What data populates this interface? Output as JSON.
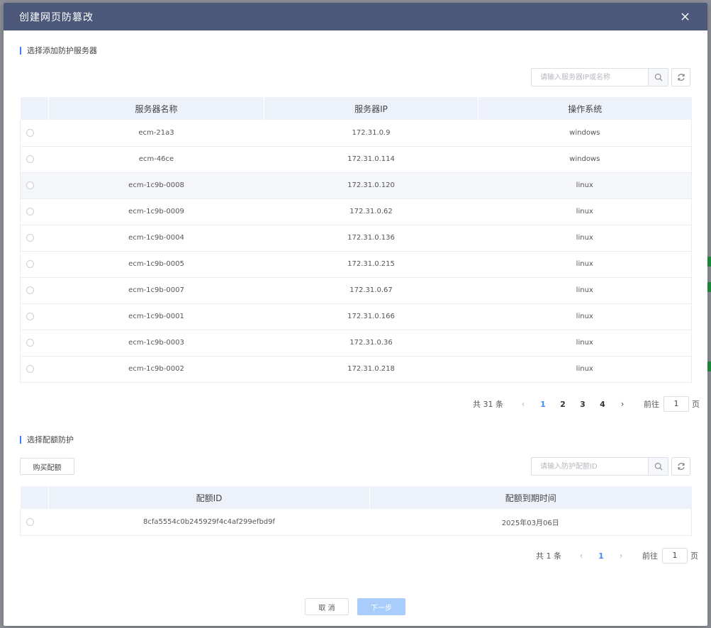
{
  "dialog": {
    "title": "创建网页防篡改"
  },
  "server_section": {
    "title": "选择添加防护服务器",
    "search_placeholder": "请输入服务器IP或名称",
    "columns": [
      "服务器名称",
      "服务器IP",
      "操作系统"
    ],
    "rows": [
      {
        "name": "ecm-21a3",
        "ip": "172.31.0.9",
        "os": "windows"
      },
      {
        "name": "ecm-46ce",
        "ip": "172.31.0.114",
        "os": "windows"
      },
      {
        "name": "ecm-1c9b-0008",
        "ip": "172.31.0.120",
        "os": "linux"
      },
      {
        "name": "ecm-1c9b-0009",
        "ip": "172.31.0.62",
        "os": "linux"
      },
      {
        "name": "ecm-1c9b-0004",
        "ip": "172.31.0.136",
        "os": "linux"
      },
      {
        "name": "ecm-1c9b-0005",
        "ip": "172.31.0.215",
        "os": "linux"
      },
      {
        "name": "ecm-1c9b-0007",
        "ip": "172.31.0.67",
        "os": "linux"
      },
      {
        "name": "ecm-1c9b-0001",
        "ip": "172.31.0.166",
        "os": "linux"
      },
      {
        "name": "ecm-1c9b-0003",
        "ip": "172.31.0.36",
        "os": "linux"
      },
      {
        "name": "ecm-1c9b-0002",
        "ip": "172.31.0.218",
        "os": "linux"
      }
    ],
    "pagination": {
      "total": "共 31 条",
      "pages": [
        "1",
        "2",
        "3",
        "4"
      ],
      "goto_label": "前往",
      "goto_value": "1",
      "page_suffix": "页"
    }
  },
  "quota_section": {
    "title": "选择配额防护",
    "buy_button": "购买配额",
    "search_placeholder": "请输入防护配额ID",
    "columns": [
      "配额ID",
      "配额到期时间"
    ],
    "rows": [
      {
        "id": "8cfa5554c0b245929f4c4af299efbd9f",
        "expire": "2025年03月06日"
      }
    ],
    "pagination": {
      "total": "共 1 条",
      "pages": [
        "1"
      ],
      "goto_label": "前往",
      "goto_value": "1",
      "page_suffix": "页"
    }
  },
  "footer": {
    "cancel": "取 消",
    "next": "下一步"
  },
  "colors": {
    "header_bg": "#4b5879",
    "accent": "#3d8bff",
    "next_disabled": "#a9cdfb"
  }
}
